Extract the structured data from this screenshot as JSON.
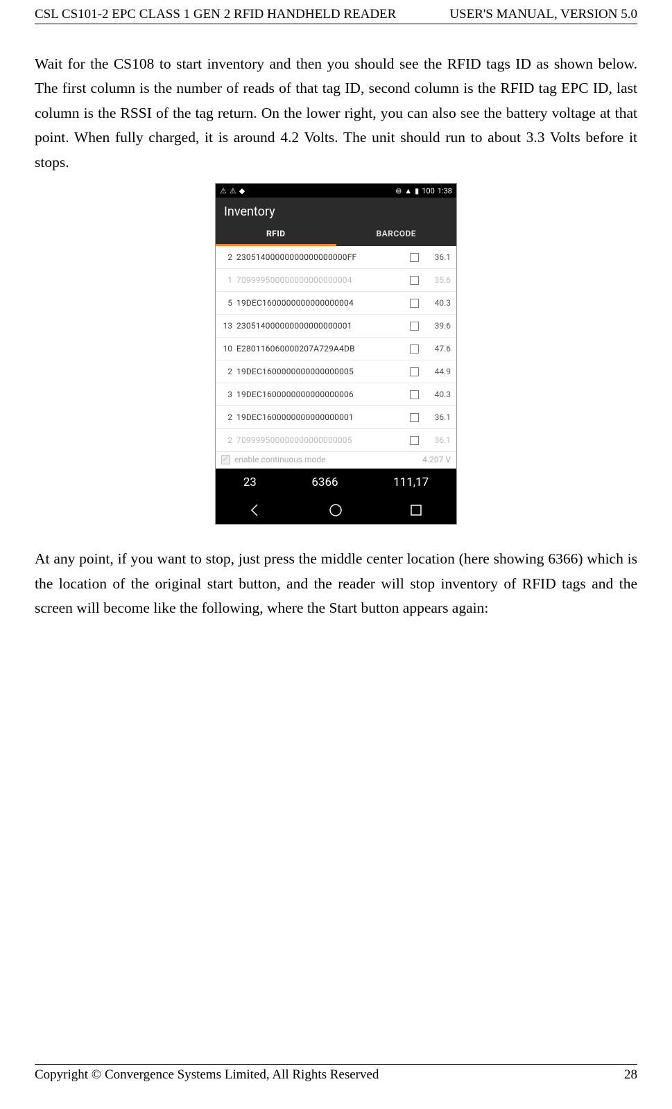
{
  "header": {
    "left": "CSL CS101-2 EPC CLASS 1 GEN 2 RFID HANDHELD READER",
    "right": "USER'S  MANUAL,  VERSION  5.0"
  },
  "para1": "Wait for the CS108 to start inventory and then you should see the RFID tags ID as shown below.   The first column is the number of reads of that tag ID, second column is the RFID tag EPC ID, last column is the RSSI of the tag return.   On the lower right, you can also see the battery voltage at that point.   When fully charged, it is around 4.2 Volts.   The unit should run to about 3.3 Volts before it stops.",
  "para2": "At any point, if you want to stop, just press the middle center location (here showing 6366) which is the location of the original start button, and the reader will stop inventory of RFID tags and the screen will become like the following, where the Start button appears again:",
  "footer": {
    "left": "Copyright © Convergence Systems Limited, All Rights Reserved",
    "right": "28"
  },
  "screenshot": {
    "status": {
      "battery": "100",
      "time": "1:38"
    },
    "title": "Inventory",
    "tabs": {
      "rfid": "RFID",
      "barcode": "BARCODE"
    },
    "rows": [
      {
        "count": "2",
        "epc": "23051400000000000000000FF",
        "rssi": "36.1"
      },
      {
        "count": "1",
        "epc": "709999500000000000000004",
        "rssi": "35.6"
      },
      {
        "count": "5",
        "epc": "19DEC1600000000000000004",
        "rssi": "40.3"
      },
      {
        "count": "13",
        "epc": "230514000000000000000001",
        "rssi": "39.6"
      },
      {
        "count": "10",
        "epc": "E280116060000207A729A4DB",
        "rssi": "47.6"
      },
      {
        "count": "2",
        "epc": "19DEC1600000000000000005",
        "rssi": "44.9"
      },
      {
        "count": "3",
        "epc": "19DEC1600000000000000006",
        "rssi": "40.3"
      },
      {
        "count": "2",
        "epc": "19DEC1600000000000000001",
        "rssi": "36.1"
      },
      {
        "count": "2",
        "epc": "709999500000000000000005",
        "rssi": "36.1"
      }
    ],
    "continuous_label": "enable continuous mode",
    "voltage": "4.207 V",
    "bottom": {
      "a": "23",
      "b": "6366",
      "c": "111,17"
    }
  }
}
